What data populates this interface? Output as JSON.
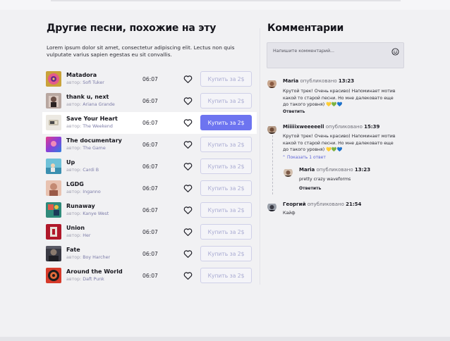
{
  "songs_section": {
    "title": "Другие песни, похожие на эту",
    "description": "Lorem ipsum dolor sit amet, consectetur adipiscing elit. Lectus non quis vulputate varius sapien egestas eu sit convallis.",
    "songs": [
      {
        "name": "Matadora",
        "author_prefix": "автор:",
        "author": "Sofi Tuker",
        "duration": "06:07",
        "buy_label": "Купить за 2$"
      },
      {
        "name": "thank u, next",
        "author_prefix": "автор:",
        "author": "Ariana Grande",
        "duration": "06:07",
        "buy_label": "Купить за 2$"
      },
      {
        "name": "Save Your Heart",
        "author_prefix": "автор:",
        "author": "The Weekend",
        "duration": "06:07",
        "buy_label": "Купить за 2$"
      },
      {
        "name": "The documentary",
        "author_prefix": "автор:",
        "author": "The Game",
        "duration": "06:07",
        "buy_label": "Купить за 2$"
      },
      {
        "name": "Up",
        "author_prefix": "автор:",
        "author": "Cardi B",
        "duration": "06:07",
        "buy_label": "Купить за 2$"
      },
      {
        "name": "LGDG",
        "author_prefix": "автор:",
        "author": "Inganno",
        "duration": "06:07",
        "buy_label": "Купить за 2$"
      },
      {
        "name": "Runaway",
        "author_prefix": "автор:",
        "author": "Kanye West",
        "duration": "06:07",
        "buy_label": "Купить за 2$"
      },
      {
        "name": "Union",
        "author_prefix": "автор:",
        "author": "Her",
        "duration": "06:07",
        "buy_label": "Купить за 2$"
      },
      {
        "name": "Fate",
        "author_prefix": "автор:",
        "author": "Boy Harcher",
        "duration": "06:07",
        "buy_label": "Купить за 2$"
      },
      {
        "name": "Around the World",
        "author_prefix": "автор:",
        "author": "Daft Punk",
        "duration": "06:07",
        "buy_label": "Купить за 2$"
      }
    ]
  },
  "comments_section": {
    "title": "Комментарии",
    "input_placeholder": "Напишите комментарий...",
    "comments": [
      {
        "author": "Maria",
        "meta": "опубликовано",
        "time": "13:23",
        "text": "Крутой трек! Очень красиво) Напоминает мотив какой то старой песни. Но мне далековато еще до такого уровня) 💛💚💙",
        "reply_label": "Ответить"
      },
      {
        "author": "Miiiiixweeeeell",
        "meta": "опубликовано",
        "time": "15:39",
        "text": "Крутой трек! Очень красиво) Напоминает мотив какой то старой песни. Но мне далековато еще до такого уровня) 💛💚💙",
        "reply_label": "Ответить",
        "show_replies_label": "Показать 1 ответ"
      },
      {
        "author": "Maria",
        "meta": "опубликовано",
        "time": "13:23",
        "text": "pretty crazy waveforms",
        "reply_label": "Ответить"
      },
      {
        "author": "Георгий",
        "meta": "опубликовано",
        "time": "21:54",
        "text": "Кайф"
      }
    ]
  },
  "colors": {
    "accent": "#6d74f0",
    "background": "#f1f1f3",
    "muted": "#a2a2b2"
  }
}
